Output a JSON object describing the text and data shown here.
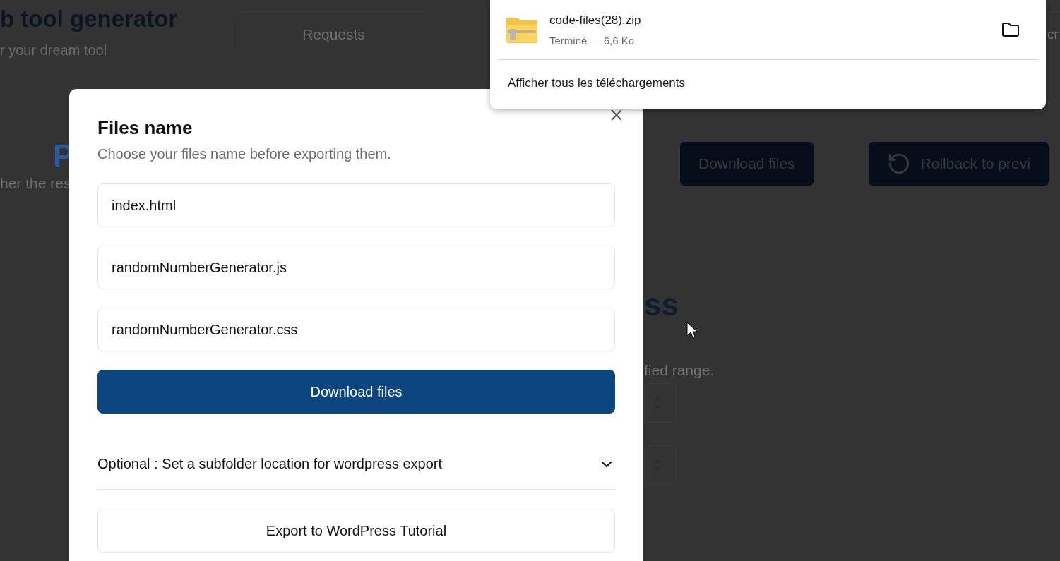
{
  "background_page": {
    "title": "b tool generator",
    "subtitle": "r your dream tool",
    "tabs": [
      "Requests",
      "cr"
    ],
    "section_heading": "P",
    "section_text": "her the res",
    "buttons": [
      {
        "kind": "plain",
        "label": "Download files"
      },
      {
        "kind": "rollback",
        "label": "Rollback to previ"
      }
    ],
    "tool_heading": "ss",
    "tool_text": "fied range."
  },
  "modal": {
    "title": "Files name",
    "subtitle": "Choose your files name before exporting them.",
    "fields": [
      {
        "value": "index.html"
      },
      {
        "value": "randomNumberGenerator.js"
      },
      {
        "value": "randomNumberGenerator.css"
      }
    ],
    "download_button": "Download files",
    "accordion": {
      "label": "Optional : Set a subfolder location for wordpress export",
      "expanded": false
    },
    "tutorial_button": "Export to WordPress Tutorial"
  },
  "downloads_panel": {
    "file_name": "code-files(28).zip",
    "status": "Terminé — 6,6 Ko",
    "show_all": "Afficher tous les téléchargements"
  }
}
